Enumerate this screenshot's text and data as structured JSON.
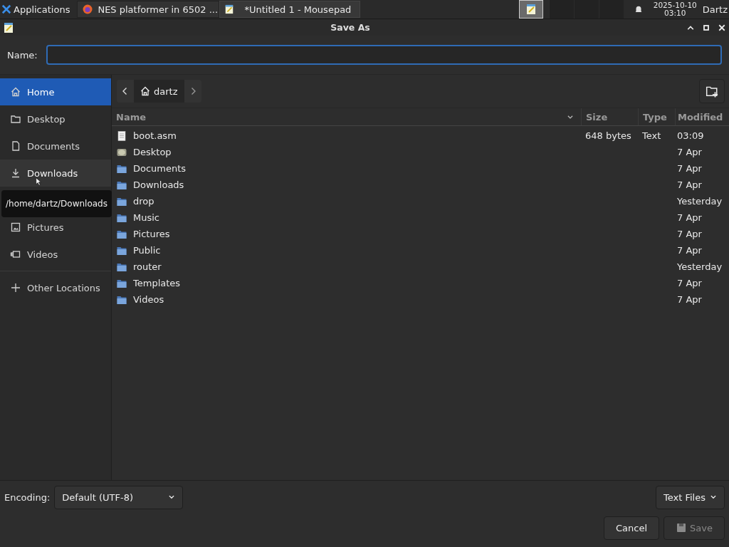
{
  "taskbar": {
    "menu": "Applications",
    "tasks": [
      {
        "title": "NES platformer in 6502 ...",
        "kind": "browser",
        "selected": false
      },
      {
        "title": "*Untitled 1 - Mousepad",
        "kind": "editor",
        "selected": true
      }
    ],
    "clock": {
      "date": "2025-10-10",
      "time": "03:10"
    },
    "user": "Dartz"
  },
  "window": {
    "title": "Save As"
  },
  "name_field": {
    "label": "Name:"
  },
  "sidebar": {
    "items": [
      {
        "label": "Home",
        "kind": "home",
        "selected": true,
        "hovered": false
      },
      {
        "label": "Desktop",
        "kind": "desktop",
        "selected": false,
        "hovered": false
      },
      {
        "label": "Documents",
        "kind": "documents",
        "selected": false,
        "hovered": false
      },
      {
        "label": "Downloads",
        "kind": "downloads",
        "selected": false,
        "hovered": true
      },
      {
        "kind": "music"
      },
      {
        "label": "Pictures",
        "kind": "pictures",
        "selected": false,
        "hovered": false
      },
      {
        "label": "Videos",
        "kind": "videos",
        "selected": false,
        "hovered": false
      },
      {
        "label": "Other Locations",
        "kind": "other",
        "selected": false,
        "hovered": false
      }
    ],
    "tooltip": "/home/dartz/Downloads"
  },
  "path_bar": {
    "current": "dartz"
  },
  "table": {
    "columns": [
      "Name",
      "Size",
      "Type",
      "Modified"
    ],
    "rows": [
      {
        "name": "boot.asm",
        "kind": "text",
        "size": "648 bytes",
        "type": "Text",
        "modified": "03:09"
      },
      {
        "name": "Desktop",
        "kind": "desktop",
        "modified": "7 Apr"
      },
      {
        "name": "Documents",
        "kind": "folder",
        "modified": "7 Apr"
      },
      {
        "name": "Downloads",
        "kind": "folder",
        "modified": "7 Apr"
      },
      {
        "name": "drop",
        "kind": "folder",
        "modified": "Yesterday"
      },
      {
        "name": "Music",
        "kind": "folder",
        "modified": "7 Apr"
      },
      {
        "name": "Pictures",
        "kind": "folder",
        "modified": "7 Apr"
      },
      {
        "name": "Public",
        "kind": "folder",
        "modified": "7 Apr"
      },
      {
        "name": "router",
        "kind": "folder",
        "modified": "Yesterday"
      },
      {
        "name": "Templates",
        "kind": "folder",
        "modified": "7 Apr"
      },
      {
        "name": "Videos",
        "kind": "folder",
        "modified": "7 Apr"
      }
    ]
  },
  "encoding": {
    "label": "Encoding:",
    "value": "Default (UTF-8)"
  },
  "filter": {
    "value": "Text Files"
  },
  "buttons": [
    {
      "label": "Cancel",
      "disabled": false
    },
    {
      "label": "Save",
      "disabled": true
    }
  ]
}
